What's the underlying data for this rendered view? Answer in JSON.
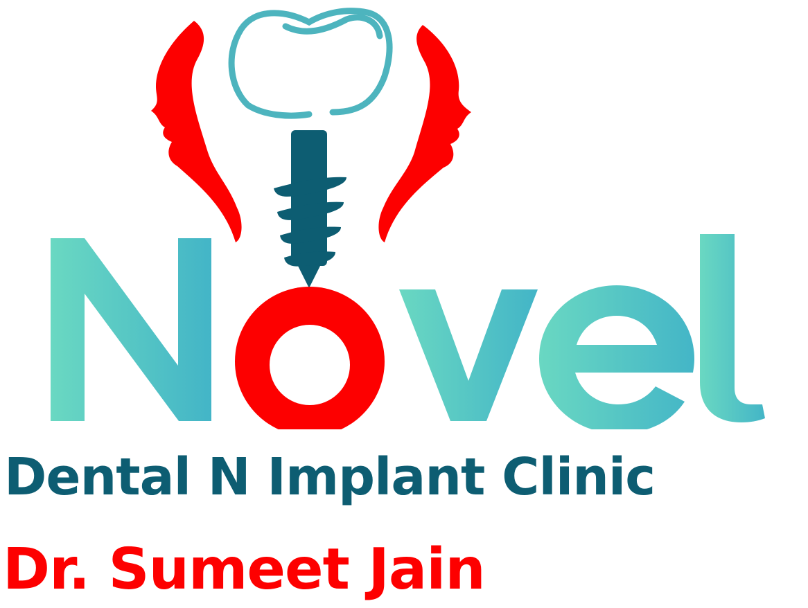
{
  "logo": {
    "wordmark": "Novel",
    "icon_names": [
      "face-profile-left-icon",
      "tooth-crown-icon",
      "implant-screw-icon",
      "face-profile-right-icon"
    ],
    "colors": {
      "teal_light": "#6ad8c2",
      "teal_mid": "#43b5c7",
      "teal_dark": "#0d5d72",
      "red": "#fd0000",
      "crown_outline": "#4db4be",
      "background": "#ffffff"
    }
  },
  "clinic": {
    "name": "Dental N Implant Clinic"
  },
  "doctor": {
    "name": "Dr. Sumeet Jain"
  }
}
